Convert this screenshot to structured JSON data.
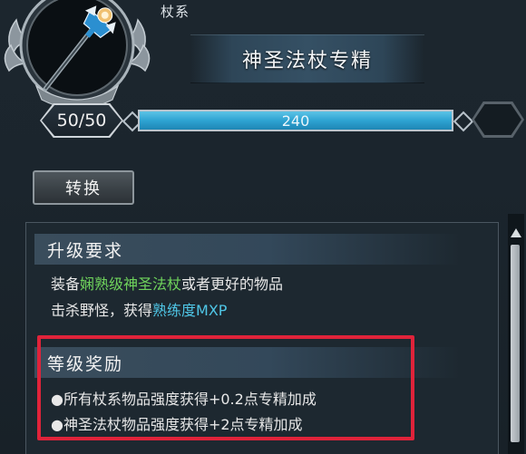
{
  "header": {
    "category": "杖系",
    "title": "神圣法杖专精",
    "emblem_icon": "holy-staff-icon"
  },
  "level": {
    "label": "50/50",
    "progress_value": "240",
    "progress_fraction": 1.0
  },
  "switch_button": {
    "label": "转换"
  },
  "requirements": {
    "heading": "升级要求",
    "line1": {
      "prefix": "装备",
      "highlight": "娴熟级神圣法杖",
      "suffix": "或者更好的物品"
    },
    "line2": {
      "prefix": "击杀野怪，获得",
      "highlight": "熟练度MXP"
    }
  },
  "rewards": {
    "heading": "等级奖励",
    "items": [
      "●所有杖系物品强度获得+0.2点专精加成",
      "●神圣法杖物品强度获得+2点专精加成"
    ]
  },
  "colors": {
    "bar_fill": "#2ea3d2",
    "highlight_green": "#6fd35c",
    "highlight_cyan": "#4fc6e6",
    "annotation_red": "#e0233a"
  }
}
